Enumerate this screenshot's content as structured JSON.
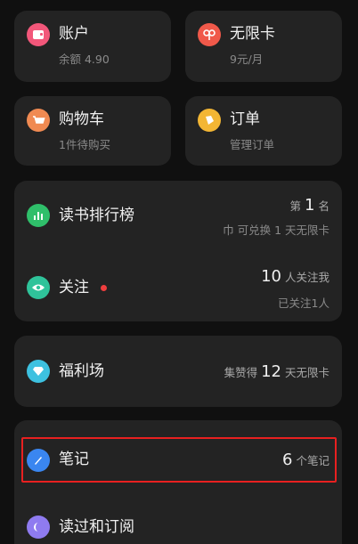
{
  "account": {
    "title": "账户",
    "sub": "余额 4.90"
  },
  "membership": {
    "title": "无限卡",
    "sub": "9元/月"
  },
  "cart": {
    "title": "购物车",
    "sub": "1件待购买"
  },
  "orders": {
    "title": "订单",
    "sub": "管理订单"
  },
  "ranking": {
    "title": "读书排行榜",
    "rank_prefix": "第",
    "rank_value": "1",
    "rank_suffix": "名",
    "sub": "巾 可兑换 1 天无限卡"
  },
  "follow": {
    "title": "关注",
    "followers_value": "10",
    "followers_suffix": "人关注我",
    "sub": "已关注1人"
  },
  "welfare": {
    "title": "福利场",
    "prefix": "集赞得",
    "value": "12",
    "suffix": "天无限卡"
  },
  "notes": {
    "title": "笔记",
    "value": "6",
    "suffix": "个笔记"
  },
  "read_subscribe": {
    "title": "读过和订阅"
  },
  "colors": {
    "account_icon": "#f2577a",
    "membership_icon": "#f0594a",
    "cart_icon": "#f08a52",
    "orders_icon": "#f3b634",
    "ranking_icon": "#2fbf6a",
    "follow_icon": "#2fc39a",
    "welfare_icon": "#3dc1e0",
    "notes_icon": "#3a86f0",
    "read_icon": "#8f7bf0",
    "highlight": "#e82020"
  }
}
